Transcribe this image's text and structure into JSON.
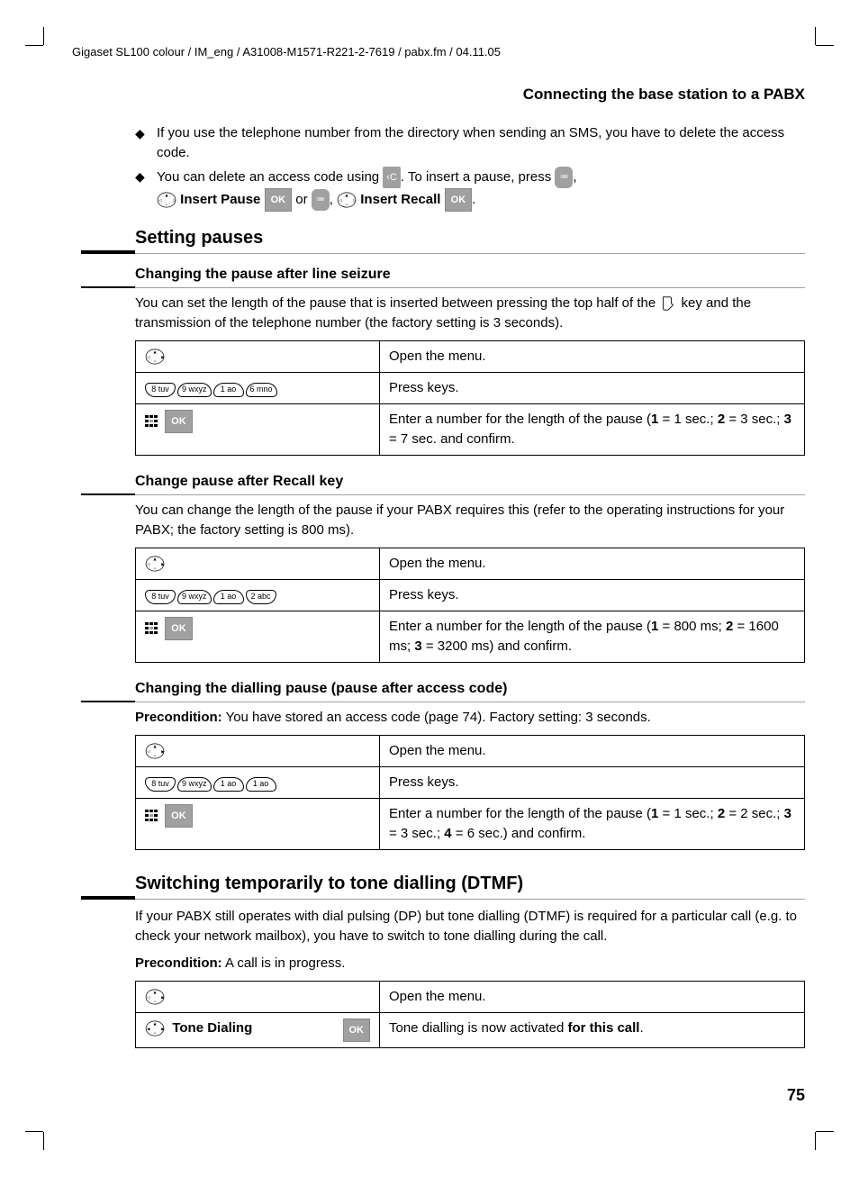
{
  "header": "Gigaset SL100 colour / IM_eng / A31008-M1571-R221-2-7619 / pabx.fm / 04.11.05",
  "section_title": "Connecting the base station to a PABX",
  "bullets": {
    "b1": "If you use the telephone number from the directory when sending an SMS, you have to delete the access code.",
    "b2a": "You can delete an access code using ",
    "b2b": ". To insert a pause, press ",
    "b2c": ", ",
    "insert_pause": "Insert Pause",
    "or": " or ",
    "insert_recall": "Insert Recall",
    "period": "."
  },
  "h2_setting": "Setting pauses",
  "h3_line_seizure": "Changing the pause after line seizure",
  "p_line_seizure": "You can set the length of the pause that is inserted between pressing the top half of the ",
  "p_line_seizure2": " key and the transmission of the telephone number (the factory setting is 3 seconds).",
  "table1": {
    "r1_right": "Open the menu.",
    "r2_right": "Press keys.",
    "r3_a": "Enter a number for the length of the pause (",
    "r3_b": " = 1 sec.; ",
    "r3_c": " = 3 sec.; ",
    "r3_d": " = 7 sec. and confirm."
  },
  "h3_recall": "Change pause after Recall key",
  "p_recall": "You can change the length of the pause if your PABX requires this (refer to the operating instructions for your PABX; the factory setting is 800 ms).",
  "table2": {
    "r1_right": "Open the menu.",
    "r2_right": "Press keys.",
    "r3_a": "Enter a number for the length of the pause (",
    "r3_b": " = 800 ms; ",
    "r3_c": " = 1600 ms; ",
    "r3_d": " = 3200 ms) and confirm."
  },
  "h3_dial": "Changing the dialling pause (pause after access code)",
  "p_dial_pre": "Precondition:",
  "p_dial": " You have stored an access code (page 74). Factory setting: 3 seconds.",
  "table3": {
    "r1_right": "Open the menu.",
    "r2_right": "Press keys.",
    "r3_a": "Enter a number for the length of the pause (",
    "r3_b": " = 1 sec.; ",
    "r3_c": " = 2 sec.; ",
    "r3_d": " = 3 sec.; ",
    "r3_e": " = 6 sec.) and confirm."
  },
  "h2_dtmf": "Switching temporarily to tone dialling (DTMF)",
  "p_dtmf": "If your PABX still operates with dial pulsing (DP) but tone dialling (DTMF) is required for a particular call (e.g. to check your network mailbox), you have to switch to tone dialling during the call.",
  "p_dtmf_pre_label": "Precondition:",
  "p_dtmf_pre": " A call is in progress.",
  "table4": {
    "r1_right": "Open the menu.",
    "r2_left_text": "Tone Dialing",
    "r2_a": "Tone dialling is now activated ",
    "r2_b": "for this call"
  },
  "keys": {
    "k8": "8 tuv",
    "k9": "9 wxyz",
    "k1": "1 ao",
    "k6": "6 mno",
    "k2": "2 abc"
  },
  "labels": {
    "ok": "OK",
    "c": "‹C",
    "menu": "≔"
  },
  "nums": {
    "n1": "1",
    "n2": "2",
    "n3": "3",
    "n4": "4"
  },
  "page_number": "75"
}
